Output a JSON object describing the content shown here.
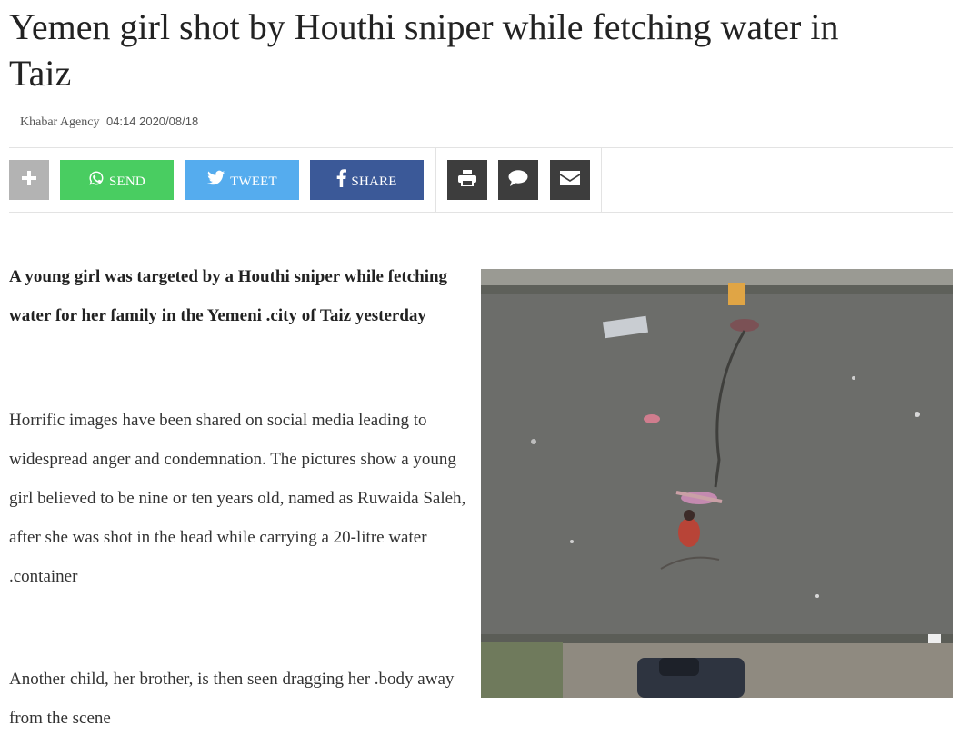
{
  "article": {
    "title": "Yemen girl shot by Houthi sniper while fetching water in Taiz",
    "source": "Khabar Agency",
    "time": "04:14 2020/08/18",
    "lead": "A young girl was targeted by a Houthi sniper while fetching water for her family in the Yemeni .city of Taiz yesterday",
    "paragraphs": [
      "Horrific images have been shared on social media leading to widespread anger and condemnation. The pictures show a young girl believed to be nine or ten years old, named as Ruwaida Saleh, after she was shot in the head while carrying a 20-litre water .container",
      "Another child, her brother, is then seen dragging her .body away from the scene"
    ]
  },
  "share_bar": {
    "send_label": "SEND",
    "tweet_label": "TWEET",
    "share_label": "SHARE",
    "icons": [
      "plus-icon",
      "whatsapp-icon",
      "twitter-icon",
      "facebook-icon",
      "print-icon",
      "comment-icon",
      "email-icon"
    ],
    "colors": {
      "more": "#b3b3b3",
      "send": "#49cd61",
      "tweet": "#55acee",
      "share": "#3b5998",
      "tools": "#3d3d3d"
    }
  }
}
